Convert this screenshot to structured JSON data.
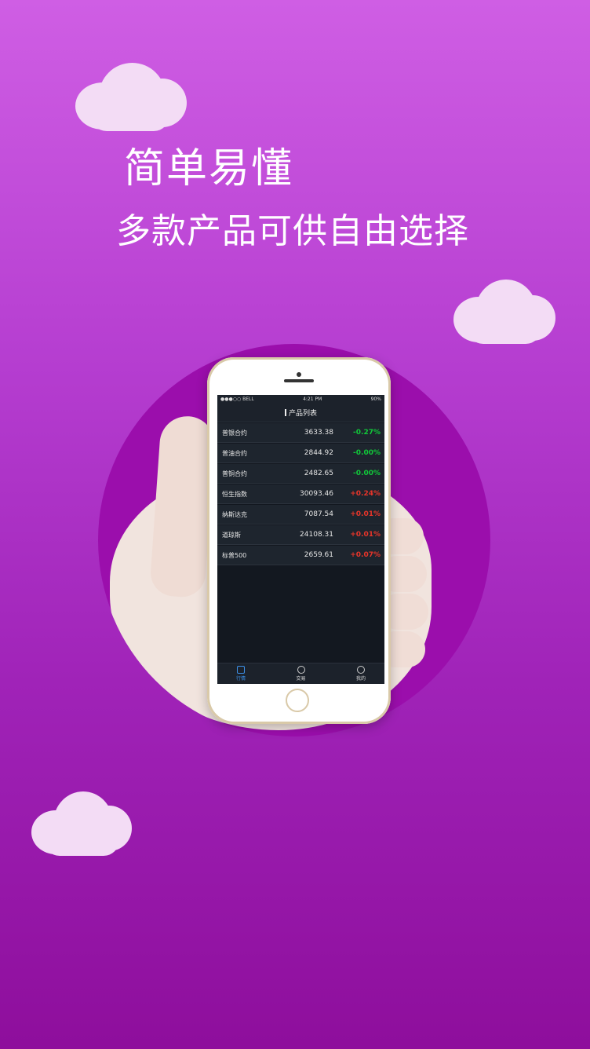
{
  "headline": "简单易懂",
  "subline": "多款产品可供自由选择",
  "colors": {
    "up": "#e8352a",
    "down": "#11c93a",
    "tab_active": "#3c8fe6"
  },
  "phone": {
    "status": {
      "carrier": "●●●○○ BELL",
      "time": "4:21 PM",
      "battery": "90%"
    },
    "title": "产品列表",
    "products": [
      {
        "name": "普银合约",
        "price": "3633.38",
        "change": "-0.27%",
        "direction": "down"
      },
      {
        "name": "普油合约",
        "price": "2844.92",
        "change": "-0.00%",
        "direction": "down"
      },
      {
        "name": "普铜合约",
        "price": "2482.65",
        "change": "-0.00%",
        "direction": "down"
      },
      {
        "name": "恒生指数",
        "price": "30093.46",
        "change": "+0.24%",
        "direction": "up"
      },
      {
        "name": "纳斯达克",
        "price": "7087.54",
        "change": "+0.01%",
        "direction": "up"
      },
      {
        "name": "道琼斯",
        "price": "24108.31",
        "change": "+0.01%",
        "direction": "up"
      },
      {
        "name": "标普500",
        "price": "2659.61",
        "change": "+0.07%",
        "direction": "up"
      }
    ],
    "tabs": [
      {
        "label": "行情",
        "icon": "chart-icon",
        "active": true
      },
      {
        "label": "交易",
        "icon": "trade-icon",
        "active": false
      },
      {
        "label": "我的",
        "icon": "user-icon",
        "active": false
      }
    ]
  }
}
